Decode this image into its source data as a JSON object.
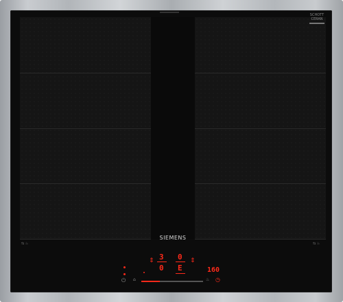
{
  "appliance": {
    "brand": "SIEMENS",
    "glass_maker": "SCHOTT",
    "glass_sub": "CERAN",
    "colors": {
      "glass": "#0c0c0c",
      "display_red": "#ff2a1a",
      "frame_steel": "#b8bcc0"
    }
  },
  "control_panel": {
    "left_zone_level": "3",
    "left_zone_sub": "0",
    "right_zone_level": "0",
    "right_zone_sub": "E",
    "timer_display": "160",
    "slider_fill_fraction": 0.3
  },
  "icons": [
    "power-icon",
    "lock-icon",
    "up-down-arrow-icon",
    "timer-icon",
    "clock-icon",
    "flex-zone-icon"
  ]
}
